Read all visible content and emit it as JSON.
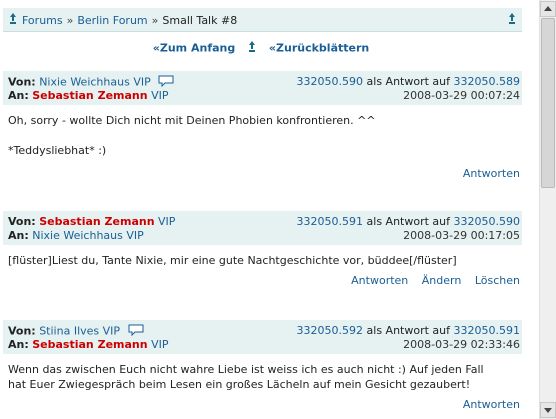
{
  "breadcrumb": {
    "items": [
      "Forums",
      "Berlin Forum"
    ],
    "separator": "»",
    "current": "Small Talk #8"
  },
  "nav": {
    "first": "«Zum Anfang",
    "back": "«Zurückblättern"
  },
  "labels": {
    "from": "Von:",
    "to": "An:",
    "as_reply_to": "als Antwort auf",
    "vip": "VIP"
  },
  "posts": [
    {
      "from": "Nixie Weichhaus",
      "from_vip": "VIP",
      "to": "Sebastian Zemann",
      "to_vip": "VIP",
      "id": "332050.590",
      "reply_to": "332050.589",
      "timestamp": "2008-03-29 00:07:24",
      "line1": "Oh, sorry - wollte Dich nicht mit Deinen Phobien konfrontieren. ^^",
      "line2": "*Teddysliebhat* :)",
      "actions": [
        "Antworten"
      ]
    },
    {
      "from": "Sebastian Zemann",
      "from_vip": "VIP",
      "to": "Nixie Weichhaus",
      "to_vip": "VIP",
      "id": "332050.591",
      "reply_to": "332050.590",
      "timestamp": "2008-03-29 00:17:05",
      "line1": "[flüster]Liest du, Tante Nixie, mir eine gute Nachtgeschichte vor, büddee[/flüster]",
      "actions": [
        "Antworten",
        "Ändern",
        "Löschen"
      ]
    },
    {
      "from": "Stiina Ilves",
      "from_vip": "VIP",
      "to": "Sebastian Zemann",
      "to_vip": "VIP",
      "id": "332050.592",
      "reply_to": "332050.591",
      "timestamp": "2008-03-29 02:33:46",
      "line1": "Wenn das zwischen Euch nicht wahre Liebe ist weiss ich es auch nicht :) Auf jeden Fall",
      "line2": "hat Euer Zwiegespräch beim Lesen ein großes Lächeln auf mein Gesicht gezaubert!",
      "actions": [
        "Antworten"
      ]
    }
  ]
}
